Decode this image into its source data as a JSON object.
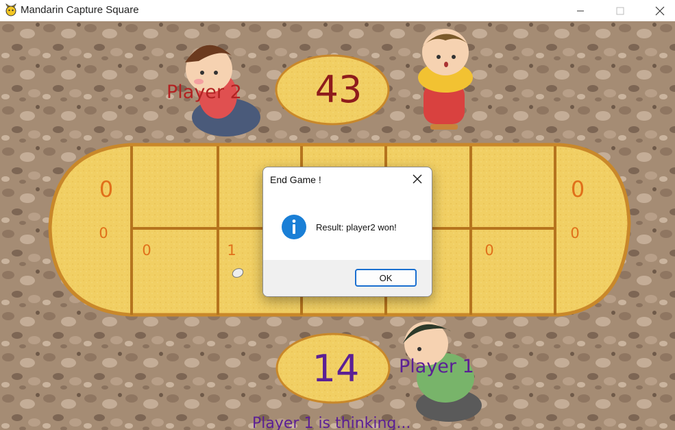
{
  "window": {
    "title": "Mandarin Capture Square",
    "controls": [
      "minimize-icon",
      "maximize-icon",
      "close-icon"
    ]
  },
  "colors": {
    "dirt_background": "#a58c74",
    "board_fill": "#f1cf63",
    "board_border": "#c9882a",
    "count_orange": "#e0701a",
    "score_red": "#8e1c1c",
    "score_purple": "#5b1f95",
    "player2_label": "#b22222",
    "player1_label": "#5b1f95"
  },
  "players": {
    "player2": {
      "label": "Player 2",
      "score": "43"
    },
    "player1": {
      "label": "Player 1",
      "score": "14"
    }
  },
  "board": {
    "left_mandarin": {
      "big": "0",
      "small": "0"
    },
    "right_mandarin": {
      "big": "0",
      "small": "0"
    },
    "top_row": [
      "",
      "",
      "",
      "",
      ""
    ],
    "bottom_row": [
      "0",
      "1",
      "",
      "",
      "0"
    ]
  },
  "status": "Player 1 is thinking...",
  "dialog": {
    "title": "End Game !",
    "message": "Result: player2 won!",
    "icon": "info-icon",
    "ok_label": "OK"
  }
}
